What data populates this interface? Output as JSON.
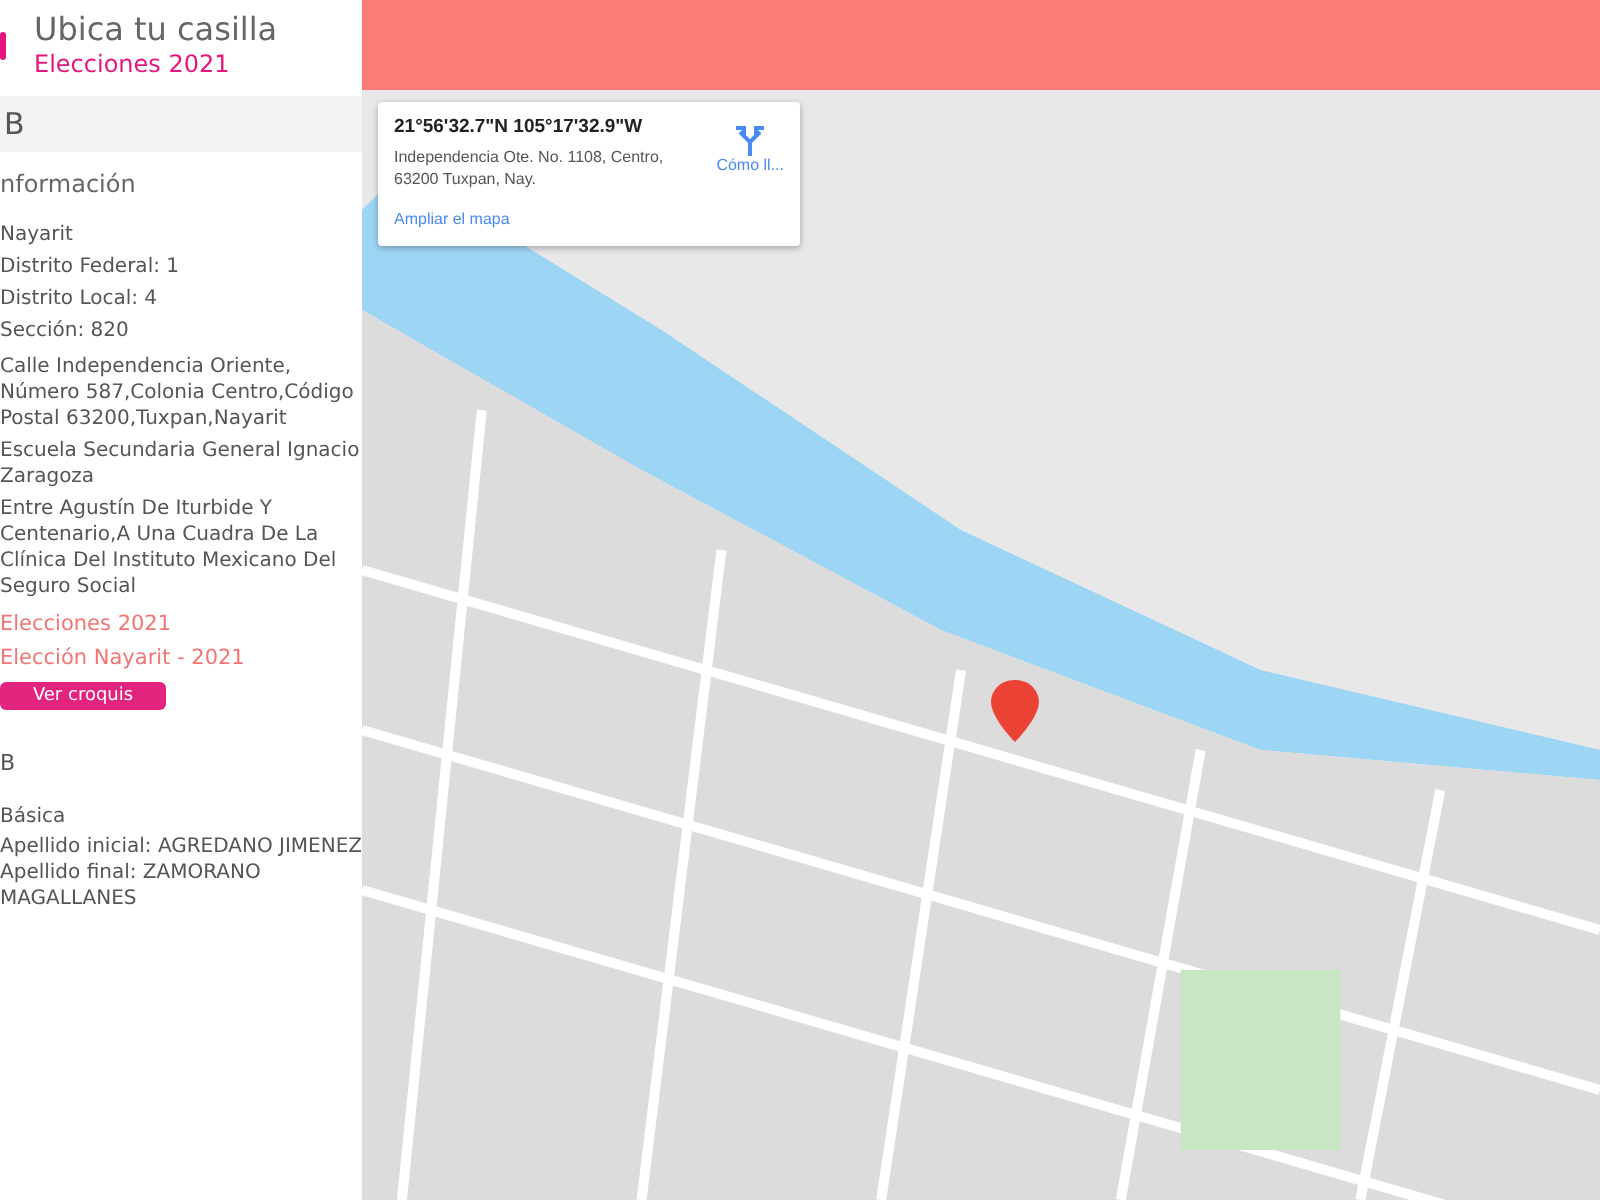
{
  "header": {
    "title": "Ubica tu casilla",
    "subtitle": "Elecciones 2021"
  },
  "sidebar": {
    "section_header": "B",
    "info_title": "nformación",
    "details": [
      "Nayarit",
      "Distrito Federal: 1",
      "Distrito Local: 4",
      "Sección: 820"
    ],
    "paragraphs": [
      "Calle Independencia Oriente, Número 587,Colonia Centro,Código Postal 63200,Tuxpan,Nayarit",
      "Escuela Secundaria General Ignacio Zaragoza",
      "Entre Agustín De Iturbide Y Centenario,A Una Cuadra De La Clínica Del Instituto Mexicano Del Seguro Social"
    ],
    "links": [
      "Elecciones 2021",
      "Elección Nayarit - 2021"
    ],
    "button": "Ver croquis",
    "section2": "B",
    "type": "Básica",
    "voters": [
      "Apellido inicial: AGREDANO JIMENEZ",
      "Apellido final: ZAMORANO MAGALLANES"
    ]
  },
  "map_card": {
    "coordinates": "21°56'32.7\"N 105°17'32.9\"W",
    "address": "Independencia Ote. No. 1108, Centro, 63200 Tuxpan, Nay.",
    "directions": "Cómo ll...",
    "enlarge": "Ampliar el mapa"
  }
}
